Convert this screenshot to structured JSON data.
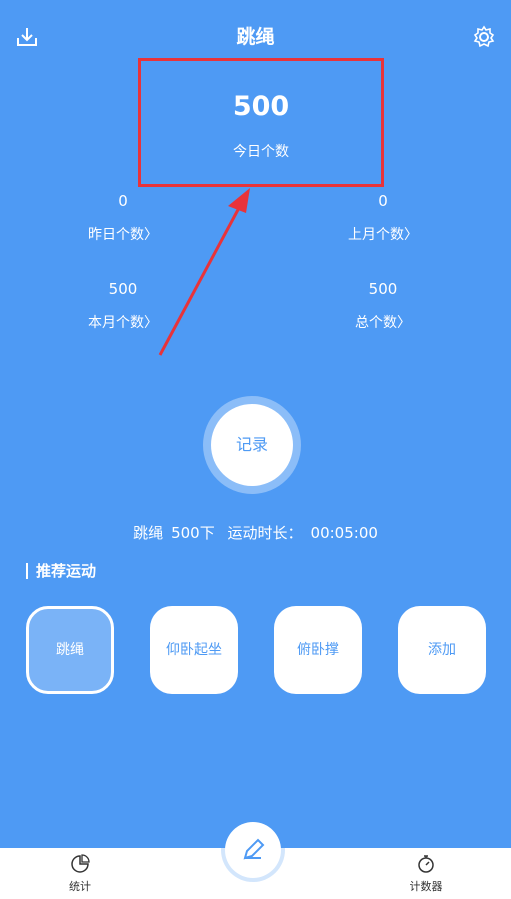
{
  "header": {
    "title": "跳绳",
    "download_icon": "download-icon",
    "settings_icon": "gear-icon"
  },
  "today": {
    "value": "500",
    "label": "今日个数"
  },
  "stats": {
    "yesterday": {
      "value": "0",
      "label": "昨日个数〉"
    },
    "last_month": {
      "value": "0",
      "label": "上月个数〉"
    },
    "this_month": {
      "value": "500",
      "label": "本月个数〉"
    },
    "total": {
      "value": "500",
      "label": "总个数〉"
    }
  },
  "record_button": {
    "label": "记录"
  },
  "summary": {
    "activity": "跳绳",
    "count": "500下",
    "duration_label": "运动时长：",
    "duration": "00:05:00"
  },
  "recommend": {
    "title": "推荐运动",
    "items": [
      {
        "label": "跳绳",
        "selected": true
      },
      {
        "label": "仰卧起坐",
        "selected": false
      },
      {
        "label": "俯卧撑",
        "selected": false
      },
      {
        "label": "添加",
        "selected": false
      }
    ]
  },
  "bottom_nav": {
    "stats_label": "统计",
    "counter_label": "计数器",
    "fab_icon": "pencil-icon"
  },
  "colors": {
    "background": "#4e9af4",
    "highlight_box": "#e8333a",
    "white": "#ffffff"
  }
}
